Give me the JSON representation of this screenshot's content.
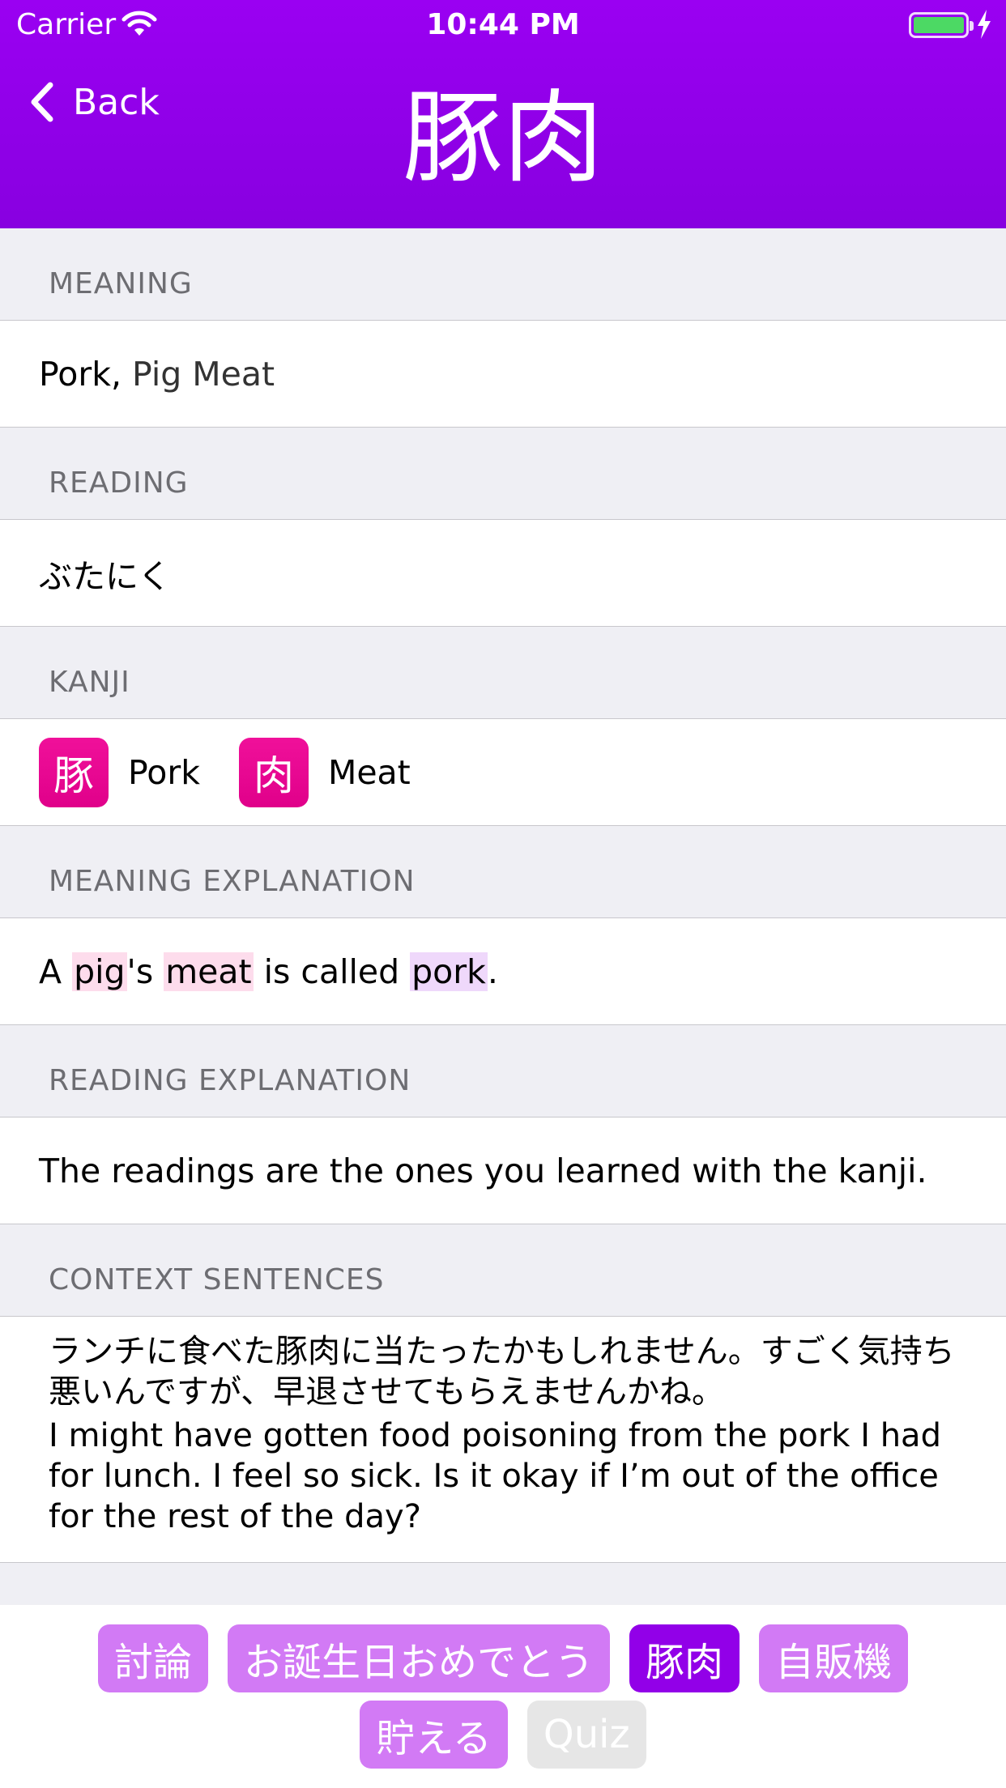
{
  "status_bar": {
    "carrier": "Carrier",
    "time": "10:44 PM"
  },
  "nav": {
    "back_label": "Back",
    "title": "豚肉"
  },
  "sections": {
    "meaning": {
      "header": "MEANING",
      "primary": "Pork,",
      "secondary": "Pig Meat"
    },
    "reading": {
      "header": "READING",
      "value": "ぶたにく"
    },
    "kanji": {
      "header": "KANJI",
      "items": [
        {
          "char": "豚",
          "meaning": "Pork"
        },
        {
          "char": "肉",
          "meaning": "Meat"
        }
      ]
    },
    "meaning_explanation": {
      "header": "MEANING EXPLANATION",
      "parts": [
        "A ",
        "pig",
        "'s ",
        "meat",
        " is called ",
        "pork",
        "."
      ]
    },
    "reading_explanation": {
      "header": "READING EXPLANATION",
      "value": "The readings are the ones you learned with the kanji."
    },
    "context_sentences": {
      "header": "CONTEXT SENTENCES",
      "japanese": "ランチに食べた豚肉に当たったかもしれません。すごく気持ち悪いんですが、早退させてもらえませんかね。",
      "english": "I might have gotten food poisoning from the pork I had for lunch. I feel so sick. Is it okay if I’m out of the office for the rest of the day?"
    }
  },
  "bottom_bar": {
    "row1": [
      "討論",
      "お誕生日おめでとう",
      "豚肉",
      "自販機"
    ],
    "row2": [
      "貯える",
      "Quiz"
    ]
  },
  "colors": {
    "header": "#9a00f2",
    "kanji_badge": "#f0109a",
    "chip": "#d27af5",
    "chip_active": "#9200e8",
    "battery": "#4cd964"
  }
}
